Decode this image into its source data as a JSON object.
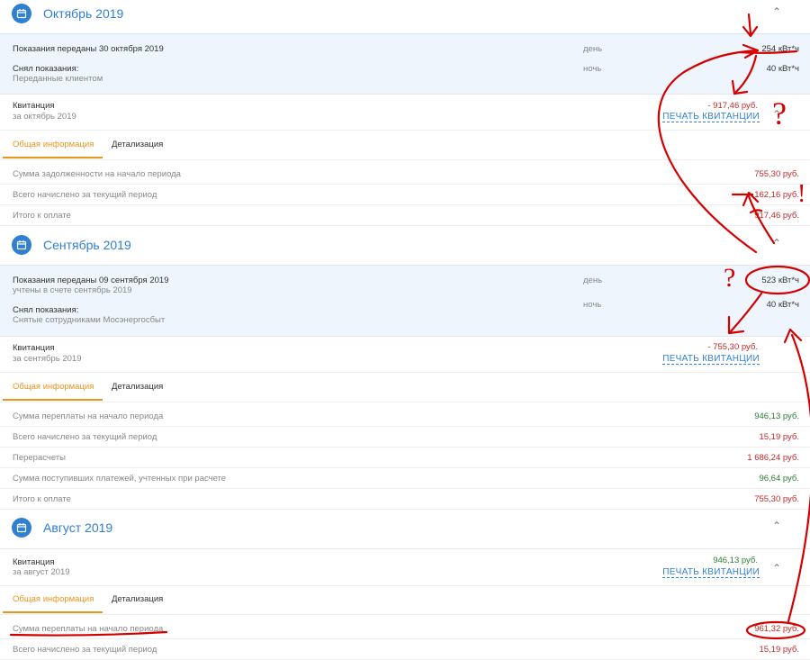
{
  "currency": "руб.",
  "colors": {
    "accent": "#2f7fd3",
    "tab_active": "#e8951d",
    "negative": "#c62828",
    "positive": "#2e7d32",
    "annotation": "#d40000"
  },
  "icons": {
    "period": "calendar-icon",
    "collapse": "chevron-up-icon"
  },
  "october": {
    "title": "Октябрь 2019",
    "readings_line": "Показания переданы 30 октября 2019",
    "taken_by_label": "Снял показания:",
    "taken_by": "Переданные клиентом",
    "day_label": "день",
    "day_value": "254 кВт*ч",
    "night_label": "ночь",
    "night_value": "40 кВт*ч",
    "receipt_label": "Квитанция",
    "receipt_period": "за октябрь 2019",
    "receipt_amount": "- 917,46 руб.",
    "print_label": "ПЕЧАТЬ КВИТАНЦИИ",
    "tab_general": "Общая информация",
    "tab_details": "Детализация",
    "rows": [
      {
        "label": "Сумма задолженности на начало периода",
        "value": "755,30 руб."
      },
      {
        "label": "Всего начислено за текущий период",
        "value": "162,16 руб."
      },
      {
        "label": "Итого к оплате",
        "value": "917,46 руб."
      }
    ]
  },
  "september": {
    "title": "Сентябрь 2019",
    "readings_line": "Показания переданы 09 сентября 2019",
    "readings_note": "учтены в счете сентябрь 2019",
    "taken_by_label": "Снял показания:",
    "taken_by": "Снятые сотрудниками Мосэнергосбыт",
    "day_label": "день",
    "day_value": "523 кВт*ч",
    "night_label": "ночь",
    "night_value": "40 кВт*ч",
    "receipt_label": "Квитанция",
    "receipt_period": "за сентябрь 2019",
    "receipt_amount": "- 755,30 руб.",
    "print_label": "ПЕЧАТЬ КВИТАНЦИИ",
    "tab_general": "Общая информация",
    "tab_details": "Детализация",
    "rows": [
      {
        "label": "Сумма переплаты на начало периода",
        "value": "946,13 руб."
      },
      {
        "label": "Всего начислено за текущий период",
        "value": "15,19 руб."
      },
      {
        "label": "Перерасчеты",
        "value": "1 686,24 руб."
      },
      {
        "label": "Сумма поступивших платежей, учтенных при расчете",
        "value": "96,64 руб."
      },
      {
        "label": "Итого к оплате",
        "value": "755,30 руб."
      }
    ]
  },
  "august": {
    "title": "Август 2019",
    "receipt_label": "Квитанция",
    "receipt_period": "за август 2019",
    "receipt_amount": "946,13 руб.",
    "print_label": "ПЕЧАТЬ КВИТАНЦИИ",
    "tab_general": "Общая информация",
    "tab_details": "Детализация",
    "rows": [
      {
        "label": "Сумма переплаты на начало периода",
        "value": "961,32 руб."
      },
      {
        "label": "Всего начислено за текущий период",
        "value": "15,19 руб."
      }
    ]
  },
  "annotations": {
    "question": "?",
    "exclamation": "!"
  }
}
